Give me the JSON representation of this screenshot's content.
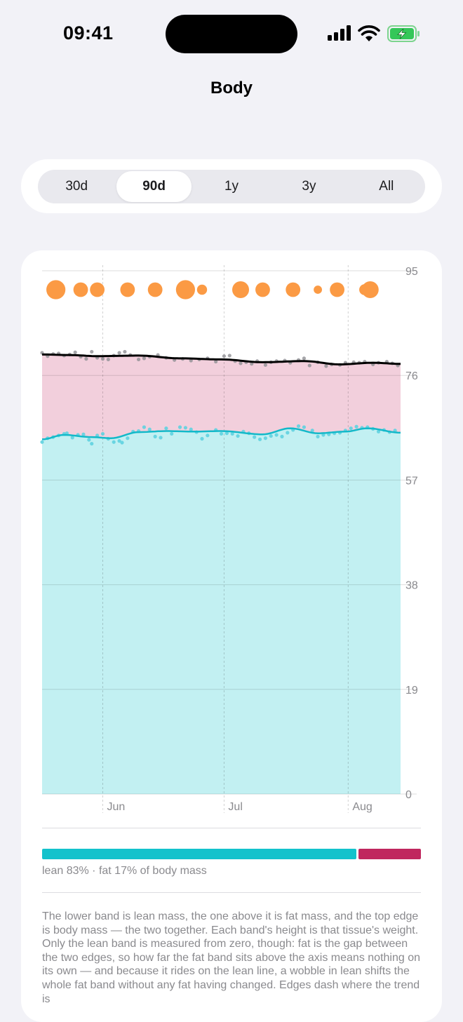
{
  "status_bar": {
    "time": "09:41"
  },
  "nav": {
    "title": "Body"
  },
  "range_selector": {
    "options": [
      "30d",
      "90d",
      "1y",
      "3y",
      "All"
    ],
    "selected": "90d"
  },
  "chart_data": {
    "type": "area",
    "y_ticks": [
      "95",
      "76",
      "57",
      "38",
      "19",
      "0"
    ],
    "ylim": [
      0,
      95
    ],
    "x_ticks": [
      {
        "label": "Jun",
        "day": 22
      },
      {
        "label": "Jul",
        "day": 66
      },
      {
        "label": "Aug",
        "day": 111
      }
    ],
    "x_range_days": [
      0,
      130
    ],
    "grid": true,
    "series": [
      {
        "name": "body mass",
        "color": "#000000",
        "trend": [
          [
            0,
            79.8
          ],
          [
            10,
            79.7
          ],
          [
            20,
            79.5
          ],
          [
            35,
            79.6
          ],
          [
            50,
            79.1
          ],
          [
            65,
            78.9
          ],
          [
            80,
            78.4
          ],
          [
            95,
            78.6
          ],
          [
            108,
            78.0
          ],
          [
            120,
            78.3
          ],
          [
            130,
            78.1
          ]
        ],
        "points": [
          [
            0,
            80.1
          ],
          [
            2,
            79.5
          ],
          [
            4,
            79.9
          ],
          [
            6,
            80.0
          ],
          [
            8,
            79.6
          ],
          [
            10,
            79.8
          ],
          [
            12,
            80.2
          ],
          [
            14,
            79.4
          ],
          [
            16,
            79.0
          ],
          [
            18,
            80.3
          ],
          [
            20,
            79.2
          ],
          [
            22,
            79.0
          ],
          [
            24,
            78.9
          ],
          [
            26,
            79.6
          ],
          [
            28,
            80.1
          ],
          [
            30,
            80.3
          ],
          [
            32,
            79.7
          ],
          [
            35,
            78.9
          ],
          [
            37,
            79.1
          ],
          [
            39,
            79.4
          ],
          [
            42,
            79.7
          ],
          [
            45,
            79.2
          ],
          [
            48,
            78.8
          ],
          [
            51,
            79.0
          ],
          [
            54,
            78.7
          ],
          [
            57,
            78.9
          ],
          [
            60,
            79.1
          ],
          [
            63,
            78.5
          ],
          [
            66,
            79.5
          ],
          [
            68,
            79.6
          ],
          [
            70,
            78.6
          ],
          [
            72,
            78.2
          ],
          [
            74,
            78.4
          ],
          [
            76,
            78.1
          ],
          [
            78,
            78.6
          ],
          [
            81,
            77.9
          ],
          [
            83,
            78.4
          ],
          [
            85,
            78.6
          ],
          [
            88,
            78.7
          ],
          [
            90,
            78.3
          ],
          [
            93,
            78.8
          ],
          [
            95,
            79.1
          ],
          [
            97,
            77.8
          ],
          [
            100,
            78.4
          ],
          [
            103,
            77.7
          ],
          [
            105,
            78.0
          ],
          [
            108,
            77.9
          ],
          [
            110,
            78.3
          ],
          [
            113,
            78.4
          ],
          [
            115,
            78.3
          ],
          [
            117,
            78.5
          ],
          [
            120,
            78.0
          ],
          [
            122,
            78.3
          ],
          [
            125,
            78.5
          ],
          [
            127,
            78.2
          ],
          [
            129,
            77.8
          ]
        ]
      },
      {
        "name": "lean mass",
        "color": "#13b9c9",
        "trend": [
          [
            0,
            64.4
          ],
          [
            8,
            65.2
          ],
          [
            18,
            64.8
          ],
          [
            25,
            64.6
          ],
          [
            35,
            65.7
          ],
          [
            45,
            65.9
          ],
          [
            55,
            65.8
          ],
          [
            65,
            65.9
          ],
          [
            80,
            65.3
          ],
          [
            90,
            66.4
          ],
          [
            100,
            65.5
          ],
          [
            110,
            65.8
          ],
          [
            118,
            66.4
          ],
          [
            130,
            65.6
          ]
        ],
        "points": [
          [
            0,
            63.9
          ],
          [
            2,
            64.6
          ],
          [
            4,
            64.8
          ],
          [
            6,
            65.1
          ],
          [
            8,
            65.4
          ],
          [
            9,
            65.5
          ],
          [
            11,
            64.7
          ],
          [
            13,
            65.2
          ],
          [
            15,
            65.3
          ],
          [
            17,
            64.3
          ],
          [
            18,
            63.6
          ],
          [
            20,
            65.1
          ],
          [
            22,
            65.4
          ],
          [
            24,
            64.5
          ],
          [
            26,
            63.9
          ],
          [
            28,
            64.1
          ],
          [
            29,
            63.8
          ],
          [
            31,
            64.6
          ],
          [
            33,
            65.8
          ],
          [
            35,
            65.9
          ],
          [
            37,
            66.6
          ],
          [
            39,
            66.2
          ],
          [
            41,
            64.9
          ],
          [
            43,
            64.7
          ],
          [
            45,
            66.4
          ],
          [
            47,
            65.4
          ],
          [
            50,
            66.6
          ],
          [
            52,
            66.5
          ],
          [
            54,
            66.2
          ],
          [
            56,
            65.7
          ],
          [
            58,
            64.5
          ],
          [
            60,
            65.1
          ],
          [
            63,
            66.1
          ],
          [
            65,
            65.4
          ],
          [
            67,
            65.5
          ],
          [
            69,
            65.4
          ],
          [
            71,
            65.0
          ],
          [
            73,
            65.8
          ],
          [
            75,
            65.5
          ],
          [
            77,
            64.8
          ],
          [
            79,
            64.4
          ],
          [
            81,
            64.6
          ],
          [
            83,
            65.0
          ],
          [
            85,
            65.2
          ],
          [
            87,
            64.9
          ],
          [
            89,
            65.6
          ],
          [
            91,
            66.1
          ],
          [
            93,
            66.8
          ],
          [
            95,
            66.6
          ],
          [
            98,
            66.0
          ],
          [
            100,
            64.9
          ],
          [
            102,
            65.2
          ],
          [
            104,
            65.3
          ],
          [
            106,
            65.5
          ],
          [
            108,
            65.6
          ],
          [
            110,
            66.0
          ],
          [
            112,
            66.4
          ],
          [
            114,
            66.7
          ],
          [
            116,
            66.5
          ],
          [
            118,
            66.6
          ],
          [
            120,
            66.3
          ],
          [
            122,
            65.8
          ],
          [
            124,
            66.1
          ],
          [
            126,
            65.7
          ],
          [
            128,
            66.0
          ]
        ]
      }
    ],
    "bubbles": [
      {
        "day": 5,
        "size": 3
      },
      {
        "day": 14,
        "size": 2
      },
      {
        "day": 20,
        "size": 2
      },
      {
        "day": 31,
        "size": 2
      },
      {
        "day": 41,
        "size": 2
      },
      {
        "day": 52,
        "size": 3
      },
      {
        "day": 58,
        "size": 1
      },
      {
        "day": 72,
        "size": 2.5
      },
      {
        "day": 80,
        "size": 2
      },
      {
        "day": 91,
        "size": 2
      },
      {
        "day": 100,
        "size": 0.6
      },
      {
        "day": 107,
        "size": 2
      },
      {
        "day": 117,
        "size": 1.2
      },
      {
        "day": 119,
        "size": 2.5
      }
    ]
  },
  "composition": {
    "lean_fraction": 0.83,
    "fat_fraction": 0.17,
    "label": "lean 83% · fat 17% of body mass"
  },
  "description": "The lower band is lean mass, the one above it is fat mass, and the top edge is body mass — the two together. Each band's height is that tissue's weight. Only the lean band is measured from zero, though: fat is the gap between the two edges, so how far the fat band sits above the axis means nothing on its own — and because it rides on the lean line, a wobble in lean shifts the whole fat band without any fat having changed. Edges dash where the trend is",
  "colors": {
    "lean": "#13c2cc",
    "lean_fill": "#c2f0f2",
    "fat": "#c0275e",
    "fat_fill": "#f2cfdc",
    "body": "#000000",
    "bubble": "#fb9a44"
  }
}
